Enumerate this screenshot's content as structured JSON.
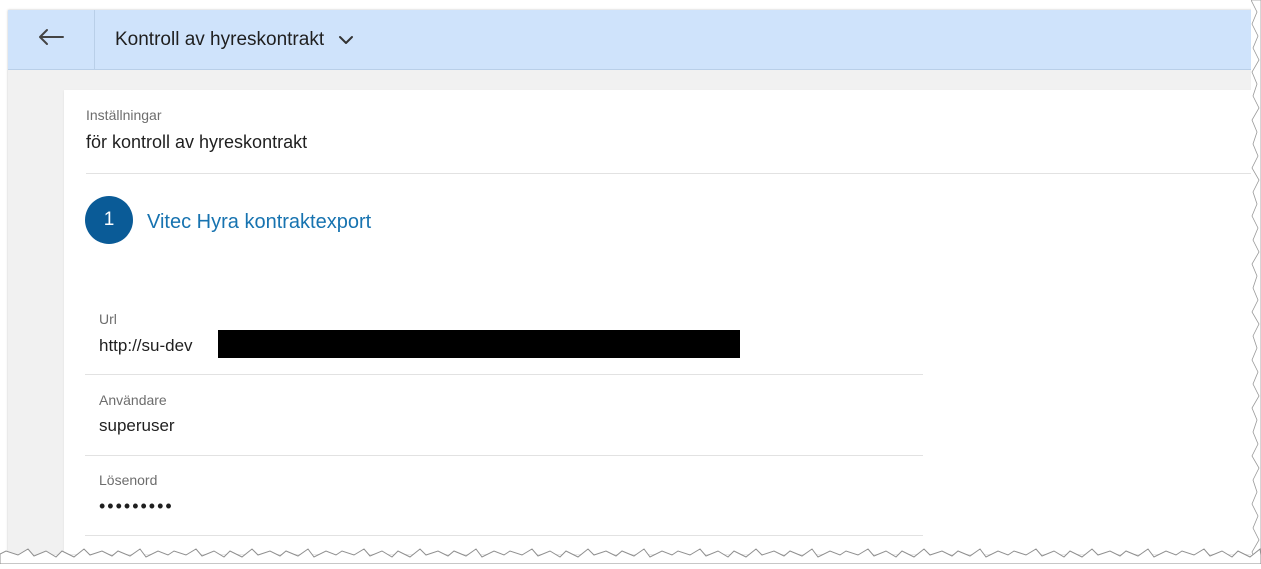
{
  "header": {
    "title": "Kontroll av hyreskontrakt",
    "back_icon": "arrow-left-icon",
    "dropdown_icon": "chevron-down-icon"
  },
  "settings": {
    "caption": "Inställningar",
    "title": "för kontroll av hyreskontrakt"
  },
  "step": {
    "number": "1",
    "title": "Vitec Hyra kontraktexport"
  },
  "fields": {
    "url": {
      "label": "Url",
      "value": "http://su-dev"
    },
    "user": {
      "label": "Användare",
      "value": "superuser"
    },
    "password": {
      "label": "Lösenord",
      "value": "•••••••••"
    }
  },
  "colors": {
    "header_bg": "#cfe3fb",
    "accent": "#0a5b97",
    "link": "#1773b0"
  }
}
